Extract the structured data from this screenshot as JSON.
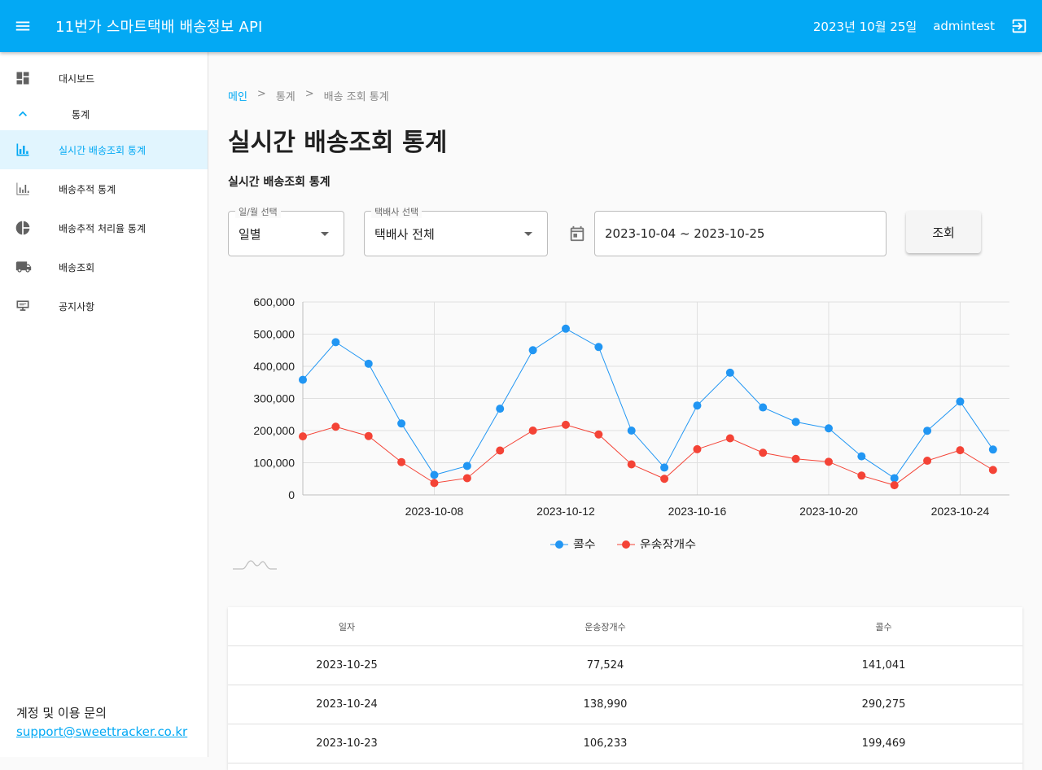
{
  "app": {
    "title": "11번가 스마트택배 배송정보 API",
    "date": "2023년 10월 25일",
    "user": "admintest"
  },
  "sidebar": {
    "items": [
      {
        "label": "대시보드",
        "icon": "dashboard-icon"
      },
      {
        "label": "통계",
        "icon": "chevron-up-icon"
      },
      {
        "label": "실시간 배송조회 통계",
        "icon": "bar-chart-icon",
        "active": true
      },
      {
        "label": "배송추적 통계",
        "icon": "bar-chart-outline-icon"
      },
      {
        "label": "배송추적 처리율 통계",
        "icon": "pie-chart-icon"
      },
      {
        "label": "배송조회",
        "icon": "truck-icon"
      },
      {
        "label": "공지사항",
        "icon": "signpost-icon"
      }
    ],
    "footer_label": "계정 및 이용 문의",
    "footer_email": "support@sweettracker.co.kr"
  },
  "breadcrumb": [
    "메인",
    ">",
    "통계",
    ">",
    "배송 조회 통계"
  ],
  "page": {
    "title": "실시간 배송조회 통계",
    "section_title": "실시간 배송조회 통계"
  },
  "filters": {
    "period_label": "일/월 선택",
    "period_value": "일별",
    "carrier_label": "택배사 선택",
    "carrier_value": "택배사 전체",
    "date_range": "2023-10-04 ~ 2023-10-25",
    "search_label": "조회"
  },
  "chart_data": {
    "type": "line",
    "x": [
      "2023-10-04",
      "2023-10-05",
      "2023-10-06",
      "2023-10-07",
      "2023-10-08",
      "2023-10-09",
      "2023-10-10",
      "2023-10-11",
      "2023-10-12",
      "2023-10-13",
      "2023-10-14",
      "2023-10-15",
      "2023-10-16",
      "2023-10-17",
      "2023-10-18",
      "2023-10-19",
      "2023-10-20",
      "2023-10-21",
      "2023-10-22",
      "2023-10-23",
      "2023-10-24",
      "2023-10-25"
    ],
    "x_tick_labels": [
      "2023-10-08",
      "2023-10-12",
      "2023-10-16",
      "2023-10-20",
      "2023-10-24"
    ],
    "y_tick_labels": [
      "0",
      "100,000",
      "200,000",
      "300,000",
      "400,000",
      "500,000",
      "600,000"
    ],
    "ylim": [
      0,
      600000
    ],
    "grid": true,
    "legend_position": "bottom",
    "series": [
      {
        "name": "콜수",
        "color": "#2196f3",
        "values": [
          358000,
          475000,
          408000,
          222000,
          62000,
          90000,
          268000,
          450000,
          517000,
          460000,
          200000,
          85000,
          278000,
          380000,
          272000,
          227000,
          207000,
          120000,
          52000,
          199469,
          290275,
          141041
        ]
      },
      {
        "name": "운송장개수",
        "color": "#f44336",
        "values": [
          182000,
          212000,
          183000,
          102000,
          37000,
          52000,
          138000,
          200000,
          218000,
          188000,
          95000,
          50000,
          142000,
          176000,
          131000,
          112000,
          103000,
          60000,
          30000,
          106233,
          138990,
          77524
        ]
      }
    ]
  },
  "table": {
    "headers": [
      "일자",
      "운송장개수",
      "콜수"
    ],
    "rows": [
      [
        "2023-10-25",
        "77,524",
        "141,041"
      ],
      [
        "2023-10-24",
        "138,990",
        "290,275"
      ],
      [
        "2023-10-23",
        "106,233",
        "199,469"
      ]
    ]
  }
}
